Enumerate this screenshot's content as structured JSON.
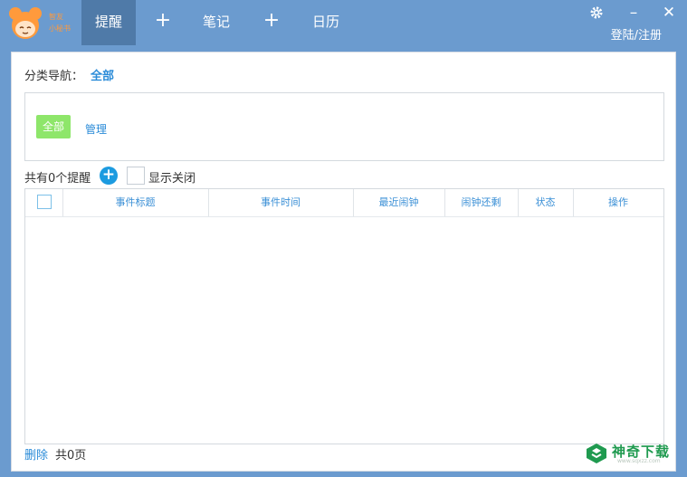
{
  "logo": {
    "line1": "智友",
    "line2": "小秘书"
  },
  "nav": {
    "tabs": [
      {
        "label": "提醒"
      },
      {
        "label": "笔记"
      },
      {
        "label": "日历"
      }
    ],
    "add_symbol": "+"
  },
  "window": {
    "settings_icon": "gear-icon",
    "minimize": "–",
    "close": "✕",
    "login_text": "登陆/注册"
  },
  "category": {
    "label": "分类导航：",
    "current": "全部",
    "buttons": {
      "all": "全部",
      "manage": "管理"
    }
  },
  "reminders": {
    "count_text": "共有0个提醒",
    "show_closed_label": "显示关闭"
  },
  "table": {
    "headers": [
      "事件标题",
      "事件时间",
      "最近闹钟",
      "闹钟还剩",
      "状态",
      "操作"
    ],
    "rows": []
  },
  "footer": {
    "delete_label": "删除",
    "pages_text": "共0页"
  },
  "watermark": {
    "text": "神奇下载",
    "sub": "www.sqxzz.com"
  },
  "colors": {
    "accent": "#2a8bd8",
    "topbar": "#6b9bcf",
    "active_tab": "#4f7aa8",
    "green": "#8ee66a"
  }
}
